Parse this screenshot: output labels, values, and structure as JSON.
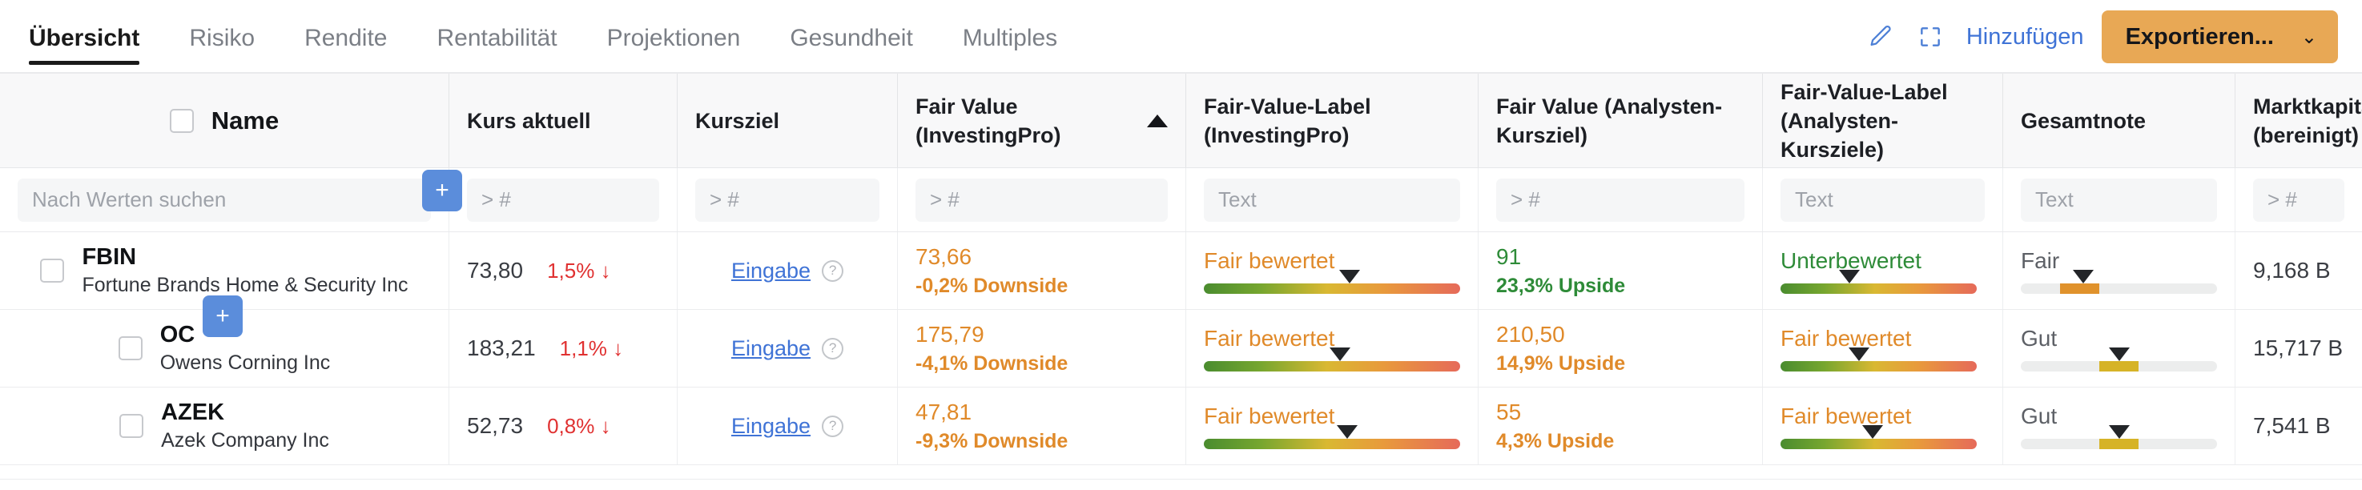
{
  "header": {
    "tabs": [
      {
        "label": "Übersicht",
        "active": true
      },
      {
        "label": "Risiko",
        "active": false
      },
      {
        "label": "Rendite",
        "active": false
      },
      {
        "label": "Rentabilität",
        "active": false
      },
      {
        "label": "Projektionen",
        "active": false
      },
      {
        "label": "Gesundheit",
        "active": false
      },
      {
        "label": "Multiples",
        "active": false
      }
    ],
    "edit_icon": "pencil-icon",
    "fullscreen_icon": "fullscreen-icon",
    "add_label": "Hinzufügen",
    "export_label": "Exportieren...",
    "export_chevron": "⌄",
    "accent_blue": "#3f73d6",
    "export_bg": "#e8a855"
  },
  "table": {
    "columns": [
      {
        "key": "name",
        "title": "Name",
        "filter_placeholder": "Nach Werten suchen",
        "sorted": false
      },
      {
        "key": "kurs",
        "title": "Kurs aktuell",
        "filter_placeholder": "> #",
        "sorted": false
      },
      {
        "key": "ziel",
        "title": "Kursziel",
        "filter_placeholder": "> #",
        "sorted": false
      },
      {
        "key": "fv",
        "title": "Fair Value (InvestingPro)",
        "filter_placeholder": "> #",
        "sorted": true,
        "sort_dir": "asc"
      },
      {
        "key": "fvl",
        "title": "Fair-Value-Label (InvestingPro)",
        "filter_placeholder": "Text",
        "sorted": false
      },
      {
        "key": "fva",
        "title": "Fair Value (Analysten-Kursziel)",
        "filter_placeholder": "> #",
        "sorted": false
      },
      {
        "key": "fval",
        "title": "Fair-Value-Label (Analysten-Kursziele)",
        "filter_placeholder": "Text",
        "sorted": false
      },
      {
        "key": "note",
        "title": "Gesamtnote",
        "filter_placeholder": "Text",
        "sorted": false
      },
      {
        "key": "mcap",
        "title": "Marktkapita (bereinigt)",
        "filter_placeholder": "> #",
        "sorted": false
      }
    ],
    "select_all_checkbox": false,
    "add_column_button_label": "+",
    "rows": [
      {
        "ticker": "FBIN",
        "company": "Fortune Brands Home & Security Inc",
        "price": "73,80",
        "change": "1,5% ↓",
        "kursziel": "Eingabe",
        "fv_value": "73,66",
        "fv_sub": "-0,2% Downside",
        "fv_color": "#e08a2a",
        "fv_label": "Fair bewertet",
        "fv_label_color": "#e08a2a",
        "fv_marker_pct": 57,
        "fva_value": "91",
        "fva_sub": "23,3% Upside",
        "fva_color": "#2e8b38",
        "fva_label": "Unterbewertet",
        "fva_label_color": "#2e8b38",
        "fva_marker_pct": 35,
        "grade": "Fair",
        "grade_marker_pct": 32,
        "grade_seg_start": 20,
        "grade_seg_width": 20,
        "grade_seg_color": "#e0922c",
        "marketcap": "9,168 B"
      },
      {
        "ticker": "OC",
        "company": "Owens Corning Inc",
        "price": "183,21",
        "change": "1,1% ↓",
        "kursziel": "Eingabe",
        "fv_value": "175,79",
        "fv_sub": "-4,1% Downside",
        "fv_color": "#e08a2a",
        "fv_label": "Fair bewertet",
        "fv_label_color": "#e08a2a",
        "fv_marker_pct": 53,
        "fva_value": "210,50",
        "fva_sub": "14,9% Upside",
        "fva_color": "#e08a2a",
        "fva_label": "Fair bewertet",
        "fva_label_color": "#e08a2a",
        "fva_marker_pct": 40,
        "grade": "Gut",
        "grade_marker_pct": 50,
        "grade_seg_start": 40,
        "grade_seg_width": 20,
        "grade_seg_color": "#d6b327",
        "marketcap": "15,717 B"
      },
      {
        "ticker": "AZEK",
        "company": "Azek Company Inc",
        "price": "52,73",
        "change": "0,8% ↓",
        "kursziel": "Eingabe",
        "fv_value": "47,81",
        "fv_sub": "-9,3% Downside",
        "fv_color": "#e08a2a",
        "fv_label": "Fair bewertet",
        "fv_label_color": "#e08a2a",
        "fv_marker_pct": 56,
        "fva_value": "55",
        "fva_sub": "4,3% Upside",
        "fva_color": "#e08a2a",
        "fva_label": "Fair bewertet",
        "fva_label_color": "#e08a2a",
        "fva_marker_pct": 47,
        "grade": "Gut",
        "grade_marker_pct": 50,
        "grade_seg_start": 40,
        "grade_seg_width": 20,
        "grade_seg_color": "#d6b327",
        "marketcap": "7,541 B"
      }
    ]
  }
}
